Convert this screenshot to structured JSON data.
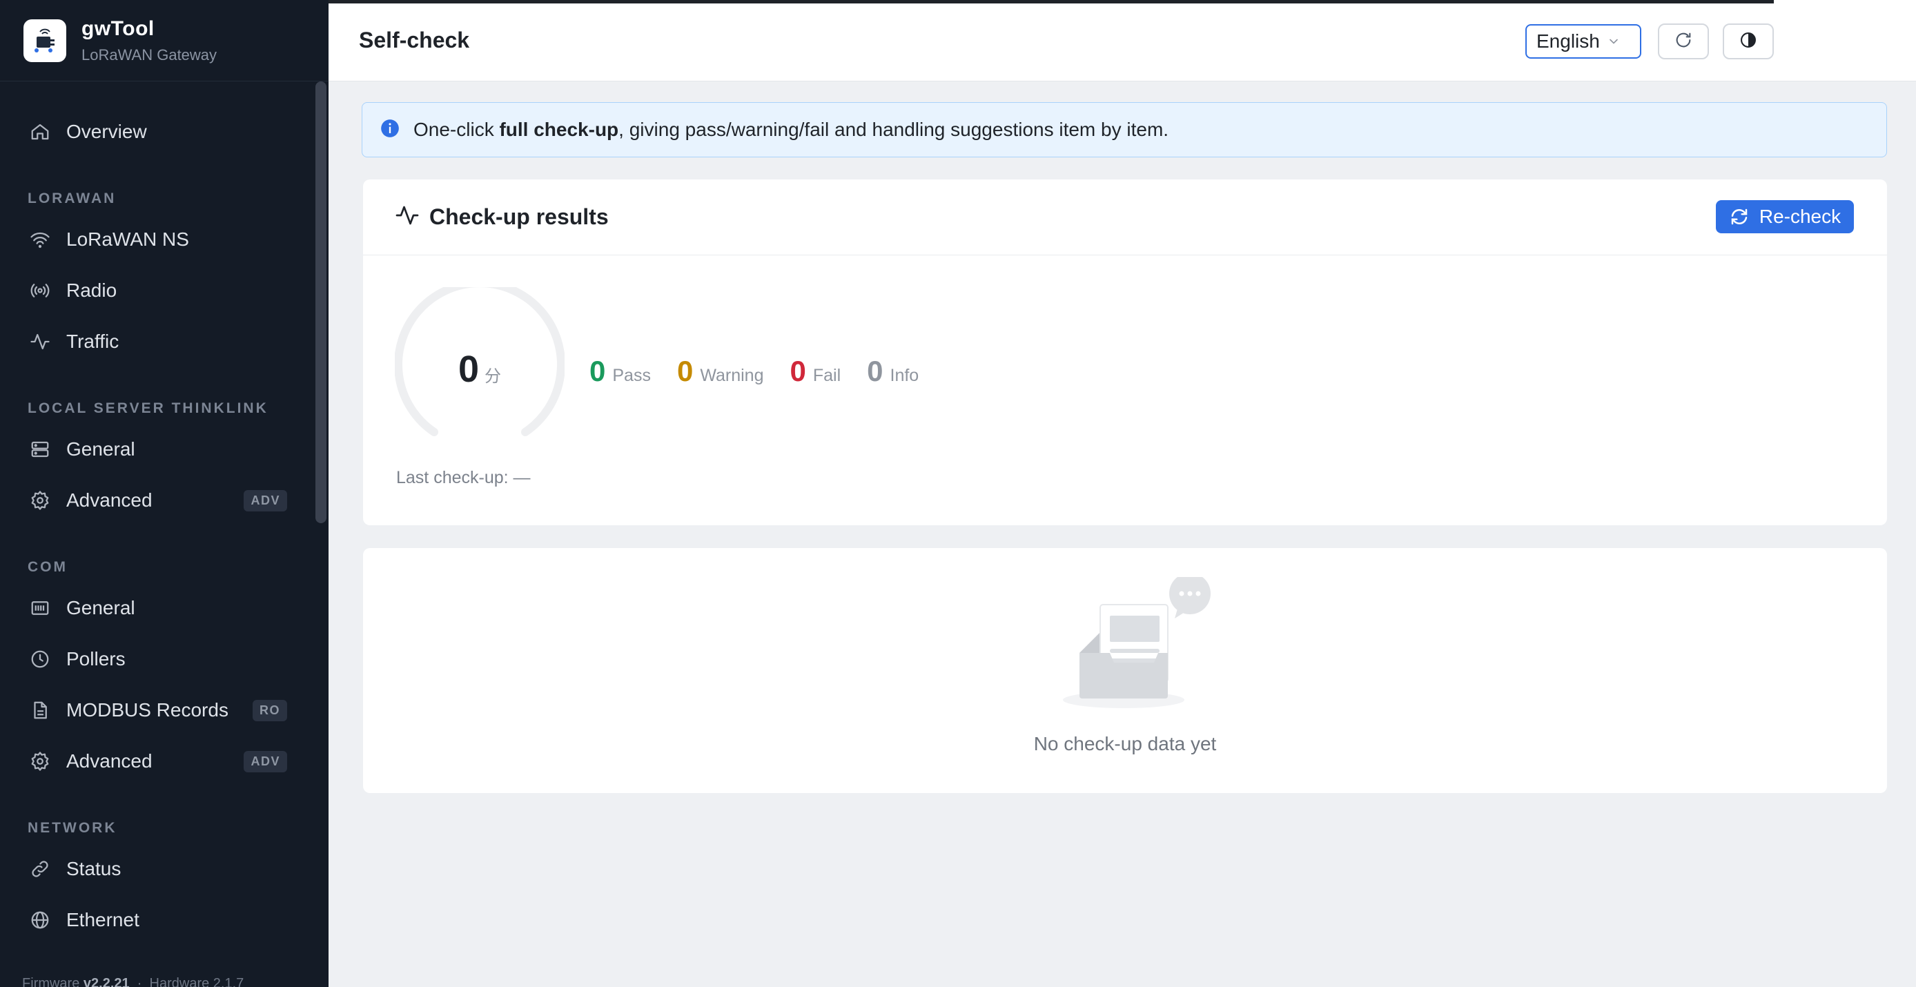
{
  "app": {
    "name": "gwTool",
    "subtitle": "LoRaWAN Gateway"
  },
  "sidebar": {
    "overview": {
      "label": "Overview",
      "icon": "home-icon"
    },
    "sections": {
      "lorawan": "LORAWAN",
      "local_server": "LOCAL SERVER THINKLINK",
      "com": "COM",
      "network": "NETWORK"
    },
    "lorawan_items": [
      {
        "label": "LoRaWAN NS",
        "icon": "wifi-icon"
      },
      {
        "label": "Radio",
        "icon": "radio-broadcast-icon"
      },
      {
        "label": "Traffic",
        "icon": "activity-icon"
      }
    ],
    "local_server_items": [
      {
        "label": "General",
        "icon": "server-icon"
      },
      {
        "label": "Advanced",
        "icon": "gear-icon",
        "badge": "ADV"
      }
    ],
    "com_items": [
      {
        "label": "General",
        "icon": "serial-port-icon"
      },
      {
        "label": "Pollers",
        "icon": "clock-icon"
      },
      {
        "label": "MODBUS Records",
        "icon": "document-icon",
        "badge": "RO"
      },
      {
        "label": "Advanced",
        "icon": "gear-icon",
        "badge": "ADV"
      }
    ],
    "network_items": [
      {
        "label": "Status",
        "icon": "link-icon"
      },
      {
        "label": "Ethernet",
        "icon": "globe-icon"
      }
    ],
    "footer": {
      "firmware_label": "Firmware",
      "firmware_version": "v2.2.21",
      "hardware_label": "Hardware",
      "hardware_version": "2.1.7"
    }
  },
  "header": {
    "title": "Self-check",
    "language": "English",
    "refresh_icon": "refresh-icon",
    "theme_icon": "contrast-icon"
  },
  "alert": {
    "prefix": "One-click ",
    "bold": "full check-up",
    "suffix": ", giving pass/warning/fail and handling suggestions item by item."
  },
  "results": {
    "title": "Check-up results",
    "recheck_label": "Re-check",
    "score": "0",
    "score_unit": "分",
    "stats": {
      "pass": {
        "value": "0",
        "label": "Pass",
        "color": "#1a9a5c"
      },
      "warning": {
        "value": "0",
        "label": "Warning",
        "color": "#c58a00"
      },
      "fail": {
        "value": "0",
        "label": "Fail",
        "color": "#d0283a"
      },
      "info": {
        "value": "0",
        "label": "Info",
        "color": "#8f959e"
      }
    },
    "last_check": "Last check-up: —"
  },
  "empty_state": {
    "text": "No check-up data yet"
  },
  "colors": {
    "accent": "#2f6fe4",
    "sidebar_bg": "#141b26",
    "page_bg": "#eef0f3"
  }
}
